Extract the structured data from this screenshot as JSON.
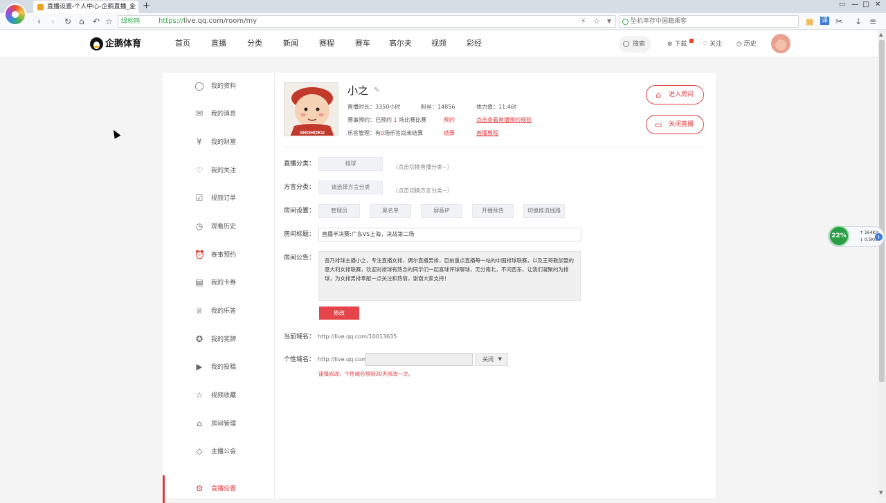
{
  "browser": {
    "tab_title": "直播设置-个人中心-企鹅直播_企",
    "tab_close": "×",
    "new_tab": "+",
    "safe_label": "绿标网",
    "url_scheme": "https://",
    "url_rest": "live.qq.com/room/my",
    "search_placeholder": "坠机幸存中国籍乘客",
    "icons": [
      "back-icon",
      "forward-icon",
      "refresh-icon",
      "home-icon",
      "undo-icon",
      "star-icon"
    ]
  },
  "header": {
    "brand": "企鹅体育",
    "nav": [
      "首页",
      "直播",
      "分类",
      "新闻",
      "赛程",
      "赛车",
      "高尔夫",
      "视频",
      "彩经"
    ],
    "search": "搜索",
    "download": "下载",
    "follow": "关注",
    "history": "历史"
  },
  "sidebar": {
    "items": [
      {
        "label": "我的资料",
        "icon": "user-icon"
      },
      {
        "label": "我的消息",
        "icon": "mail-icon"
      },
      {
        "label": "我的财富",
        "icon": "yen-icon"
      },
      {
        "label": "我的关注",
        "icon": "heart-icon"
      },
      {
        "label": "视频订单",
        "icon": "check-icon"
      },
      {
        "label": "观看历史",
        "icon": "clock-icon"
      },
      {
        "label": "赛事预约",
        "icon": "alarm-icon"
      },
      {
        "label": "我的卡券",
        "icon": "ticket-icon"
      },
      {
        "label": "我的乐答",
        "icon": "trophy-icon"
      },
      {
        "label": "我的奖牌",
        "icon": "medal-icon"
      },
      {
        "label": "我的投稿",
        "icon": "video-icon"
      },
      {
        "label": "视频收藏",
        "icon": "star-icon"
      },
      {
        "label": "房间管理",
        "icon": "house-icon"
      },
      {
        "label": "主播公会",
        "icon": "diamond-icon"
      },
      {
        "label": "直播设置",
        "icon": "gear-icon",
        "active": true
      }
    ]
  },
  "profile": {
    "name": "小之",
    "avatar_text": "SHOHOKU",
    "live_time_label": "直播时长：",
    "live_time_value": "3350小时",
    "fans_label": "粉丝：",
    "fans_value": "14856",
    "power_label": "体力值：",
    "power_value": "11.46t",
    "booking_prefix": "赛事预约：已预约",
    "booking_count": "1",
    "booking_suffix": "场比赛比赛",
    "booking_link": "预约",
    "booking_rule_link": "点击查看直播预约规则",
    "quiz_prefix": "乐答管理：有",
    "quiz_count": "0",
    "quiz_suffix": "场乐答尚未结算",
    "quiz_link": "结算",
    "tutorial_link": "直播教程",
    "enter_room": "进入房间",
    "close_live": "关闭直播"
  },
  "settings": {
    "category_label": "直播分类：",
    "category_value": "排球",
    "category_hint": "（点击切换直播分类~）",
    "dialect_label": "方言分类：",
    "dialect_value": "请选择方言分类",
    "dialect_hint": "（点击切换方言分类~）",
    "room_label": "房间设置：",
    "room_buttons": [
      "管理员",
      "黑名单",
      "屏蔽IP",
      "开播预告",
      "切换推流线路"
    ],
    "title_label": "房间标题：",
    "title_value": "直播半决赛:广东VS上海，决战第二场",
    "notice_label": "房间公告：",
    "notice_text": "吾乃排球主播小之，专注直播女排，偶尔直播男排，目前重点直播每一站的中国排球联赛，以及王哥教加盟的意大利女排联赛，欢迎对排球有热念的同学们一起喜球评球聊球，无分南北，不问西东，让我们凝聚的为排球，为女排男排奉献一点关注和热情，谢谢大家支持！",
    "edit_button": "修改",
    "domain_label": "当前域名：",
    "domain_value": "http://live.qq.com/10013635",
    "custom_label": "个性域名：",
    "custom_prefix": "http://live.qq.com/",
    "custom_select": "关闭",
    "custom_warning": "谨慎修改，个性域名限制30天修改一次。"
  },
  "net": {
    "percent": "22%",
    "up": "164K/s",
    "down": "0.5K/s"
  }
}
